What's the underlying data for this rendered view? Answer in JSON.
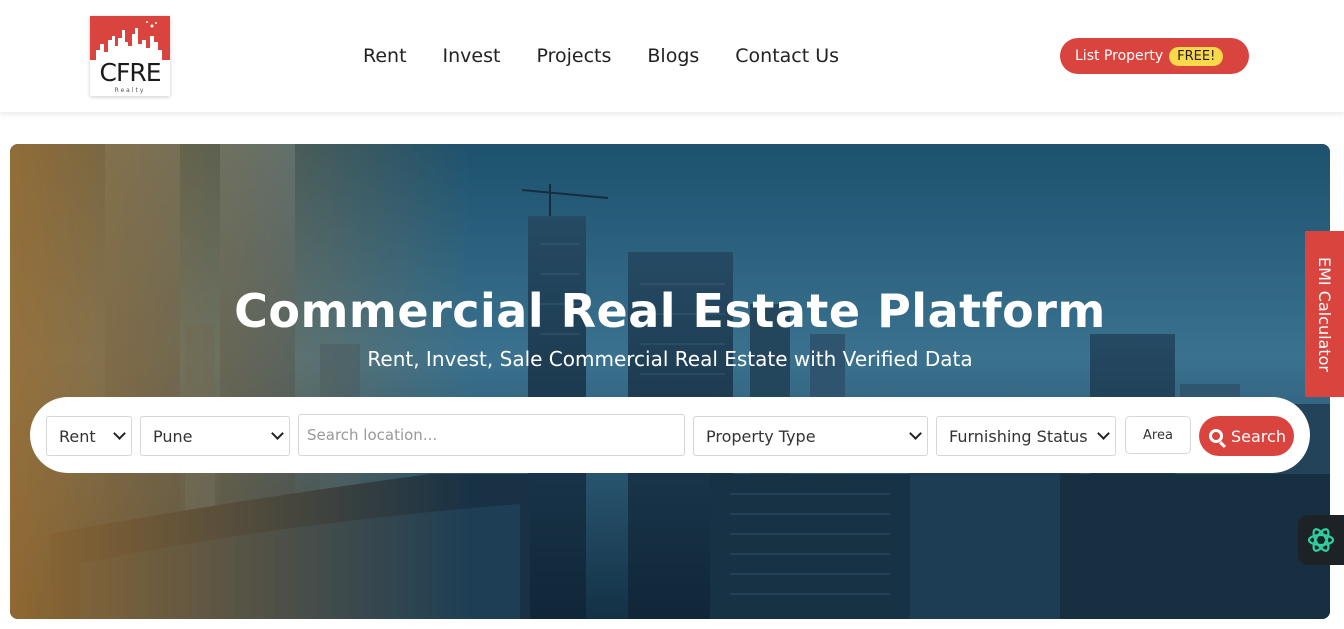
{
  "header": {
    "logo": {
      "text": "CFRE",
      "subtext": "Realty",
      "icon": "city-skyline-logo"
    },
    "nav": [
      {
        "label": "Rent"
      },
      {
        "label": "Invest"
      },
      {
        "label": "Projects"
      },
      {
        "label": "Blogs"
      },
      {
        "label": "Contact Us"
      }
    ],
    "list_property": {
      "label": "List Property",
      "badge": "FREE!"
    }
  },
  "hero": {
    "title": "Commercial Real Estate Platform",
    "subtitle": "Rent, Invest, Sale Commercial Real Estate with Verified Data"
  },
  "search": {
    "transaction_type": "Rent",
    "city": "Pune",
    "location_placeholder": "Search location...",
    "property_type": "Property Type",
    "furnishing_status": "Furnishing Status",
    "area_label": "Area",
    "search_label": "Search"
  },
  "side_tabs": {
    "emi_calculator": "EMI Calculator",
    "chat_icon": "openai-chat-icon"
  },
  "colors": {
    "brand_red": "#d9443f",
    "badge_yellow": "#f9d84a",
    "nav_text": "#222222"
  }
}
